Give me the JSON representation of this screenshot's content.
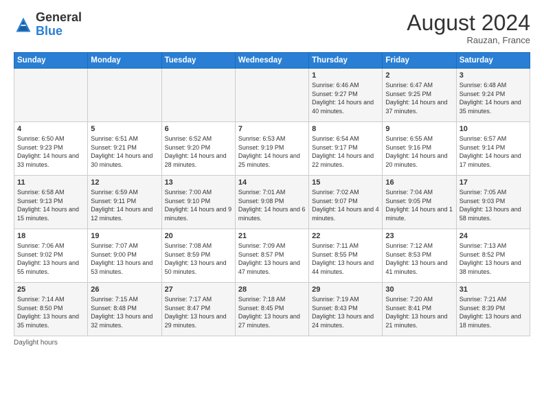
{
  "header": {
    "logo_general": "General",
    "logo_blue": "Blue",
    "month_title": "August 2024",
    "location": "Rauzan, France"
  },
  "days_of_week": [
    "Sunday",
    "Monday",
    "Tuesday",
    "Wednesday",
    "Thursday",
    "Friday",
    "Saturday"
  ],
  "footer_text": "Daylight hours",
  "weeks": [
    [
      {
        "day": "",
        "sunrise": "",
        "sunset": "",
        "daylight": ""
      },
      {
        "day": "",
        "sunrise": "",
        "sunset": "",
        "daylight": ""
      },
      {
        "day": "",
        "sunrise": "",
        "sunset": "",
        "daylight": ""
      },
      {
        "day": "",
        "sunrise": "",
        "sunset": "",
        "daylight": ""
      },
      {
        "day": "1",
        "sunrise": "Sunrise: 6:46 AM",
        "sunset": "Sunset: 9:27 PM",
        "daylight": "Daylight: 14 hours and 40 minutes."
      },
      {
        "day": "2",
        "sunrise": "Sunrise: 6:47 AM",
        "sunset": "Sunset: 9:25 PM",
        "daylight": "Daylight: 14 hours and 37 minutes."
      },
      {
        "day": "3",
        "sunrise": "Sunrise: 6:48 AM",
        "sunset": "Sunset: 9:24 PM",
        "daylight": "Daylight: 14 hours and 35 minutes."
      }
    ],
    [
      {
        "day": "4",
        "sunrise": "Sunrise: 6:50 AM",
        "sunset": "Sunset: 9:23 PM",
        "daylight": "Daylight: 14 hours and 33 minutes."
      },
      {
        "day": "5",
        "sunrise": "Sunrise: 6:51 AM",
        "sunset": "Sunset: 9:21 PM",
        "daylight": "Daylight: 14 hours and 30 minutes."
      },
      {
        "day": "6",
        "sunrise": "Sunrise: 6:52 AM",
        "sunset": "Sunset: 9:20 PM",
        "daylight": "Daylight: 14 hours and 28 minutes."
      },
      {
        "day": "7",
        "sunrise": "Sunrise: 6:53 AM",
        "sunset": "Sunset: 9:19 PM",
        "daylight": "Daylight: 14 hours and 25 minutes."
      },
      {
        "day": "8",
        "sunrise": "Sunrise: 6:54 AM",
        "sunset": "Sunset: 9:17 PM",
        "daylight": "Daylight: 14 hours and 22 minutes."
      },
      {
        "day": "9",
        "sunrise": "Sunrise: 6:55 AM",
        "sunset": "Sunset: 9:16 PM",
        "daylight": "Daylight: 14 hours and 20 minutes."
      },
      {
        "day": "10",
        "sunrise": "Sunrise: 6:57 AM",
        "sunset": "Sunset: 9:14 PM",
        "daylight": "Daylight: 14 hours and 17 minutes."
      }
    ],
    [
      {
        "day": "11",
        "sunrise": "Sunrise: 6:58 AM",
        "sunset": "Sunset: 9:13 PM",
        "daylight": "Daylight: 14 hours and 15 minutes."
      },
      {
        "day": "12",
        "sunrise": "Sunrise: 6:59 AM",
        "sunset": "Sunset: 9:11 PM",
        "daylight": "Daylight: 14 hours and 12 minutes."
      },
      {
        "day": "13",
        "sunrise": "Sunrise: 7:00 AM",
        "sunset": "Sunset: 9:10 PM",
        "daylight": "Daylight: 14 hours and 9 minutes."
      },
      {
        "day": "14",
        "sunrise": "Sunrise: 7:01 AM",
        "sunset": "Sunset: 9:08 PM",
        "daylight": "Daylight: 14 hours and 6 minutes."
      },
      {
        "day": "15",
        "sunrise": "Sunrise: 7:02 AM",
        "sunset": "Sunset: 9:07 PM",
        "daylight": "Daylight: 14 hours and 4 minutes."
      },
      {
        "day": "16",
        "sunrise": "Sunrise: 7:04 AM",
        "sunset": "Sunset: 9:05 PM",
        "daylight": "Daylight: 14 hours and 1 minute."
      },
      {
        "day": "17",
        "sunrise": "Sunrise: 7:05 AM",
        "sunset": "Sunset: 9:03 PM",
        "daylight": "Daylight: 13 hours and 58 minutes."
      }
    ],
    [
      {
        "day": "18",
        "sunrise": "Sunrise: 7:06 AM",
        "sunset": "Sunset: 9:02 PM",
        "daylight": "Daylight: 13 hours and 55 minutes."
      },
      {
        "day": "19",
        "sunrise": "Sunrise: 7:07 AM",
        "sunset": "Sunset: 9:00 PM",
        "daylight": "Daylight: 13 hours and 53 minutes."
      },
      {
        "day": "20",
        "sunrise": "Sunrise: 7:08 AM",
        "sunset": "Sunset: 8:59 PM",
        "daylight": "Daylight: 13 hours and 50 minutes."
      },
      {
        "day": "21",
        "sunrise": "Sunrise: 7:09 AM",
        "sunset": "Sunset: 8:57 PM",
        "daylight": "Daylight: 13 hours and 47 minutes."
      },
      {
        "day": "22",
        "sunrise": "Sunrise: 7:11 AM",
        "sunset": "Sunset: 8:55 PM",
        "daylight": "Daylight: 13 hours and 44 minutes."
      },
      {
        "day": "23",
        "sunrise": "Sunrise: 7:12 AM",
        "sunset": "Sunset: 8:53 PM",
        "daylight": "Daylight: 13 hours and 41 minutes."
      },
      {
        "day": "24",
        "sunrise": "Sunrise: 7:13 AM",
        "sunset": "Sunset: 8:52 PM",
        "daylight": "Daylight: 13 hours and 38 minutes."
      }
    ],
    [
      {
        "day": "25",
        "sunrise": "Sunrise: 7:14 AM",
        "sunset": "Sunset: 8:50 PM",
        "daylight": "Daylight: 13 hours and 35 minutes."
      },
      {
        "day": "26",
        "sunrise": "Sunrise: 7:15 AM",
        "sunset": "Sunset: 8:48 PM",
        "daylight": "Daylight: 13 hours and 32 minutes."
      },
      {
        "day": "27",
        "sunrise": "Sunrise: 7:17 AM",
        "sunset": "Sunset: 8:47 PM",
        "daylight": "Daylight: 13 hours and 29 minutes."
      },
      {
        "day": "28",
        "sunrise": "Sunrise: 7:18 AM",
        "sunset": "Sunset: 8:45 PM",
        "daylight": "Daylight: 13 hours and 27 minutes."
      },
      {
        "day": "29",
        "sunrise": "Sunrise: 7:19 AM",
        "sunset": "Sunset: 8:43 PM",
        "daylight": "Daylight: 13 hours and 24 minutes."
      },
      {
        "day": "30",
        "sunrise": "Sunrise: 7:20 AM",
        "sunset": "Sunset: 8:41 PM",
        "daylight": "Daylight: 13 hours and 21 minutes."
      },
      {
        "day": "31",
        "sunrise": "Sunrise: 7:21 AM",
        "sunset": "Sunset: 8:39 PM",
        "daylight": "Daylight: 13 hours and 18 minutes."
      }
    ]
  ]
}
